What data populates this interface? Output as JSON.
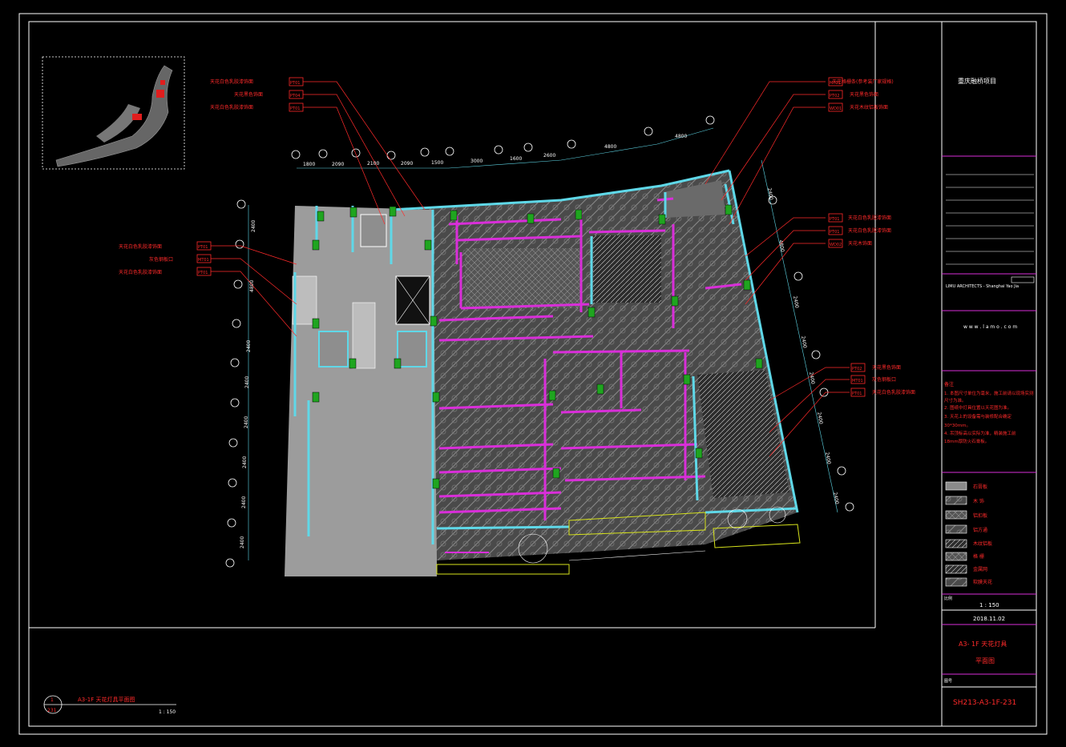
{
  "project_title": "重庆融桥项目",
  "firm": {
    "name_line": "LIMU ARCHITECTS - Shanghai Yao Jia",
    "website": "w w w . l a m o . c o m"
  },
  "notes": {
    "heading": "备注",
    "lines": [
      "1. 本图尺寸单位为毫米，施工前请以现场实测",
      "尺寸为准。",
      "2. 图纸中灯具位置以天花图为准。",
      "3. 天花上的设备需与装修配合确定",
      "30*30mm。",
      "4. 吊顶标高以实际为准，精装施工前",
      "18mm厚防火石膏板。"
    ]
  },
  "legend": [
    {
      "label": "石膏板"
    },
    {
      "label": "木  饰"
    },
    {
      "label": "铝扣板"
    },
    {
      "label": "铝方通"
    },
    {
      "label": "木纹铝板"
    },
    {
      "label": "格  栅"
    },
    {
      "label": "金属网"
    },
    {
      "label": "软膜天花"
    }
  ],
  "scale_label": "比例",
  "scale": "1 : 150",
  "date_label": "日期",
  "date": "2018.11.02",
  "sheet_title_line1": "A3- 1F  天花灯具",
  "sheet_title_line2": "平面图",
  "number_label": "图号",
  "drawing_number": "SH213-A3-1F-231",
  "bottom_caption": {
    "num": "1",
    "sheet": "231",
    "title": "A3-1F  天花灯具平面图",
    "scale": "1 : 150"
  },
  "top_dims": [
    "1800",
    "2090",
    "2100",
    "2090",
    "1500",
    "3000",
    "1600",
    "2600",
    "4800",
    "4800"
  ],
  "left_dims": [
    "2400",
    "4800",
    "2400",
    "2400",
    "2400",
    "2400",
    "2400",
    "2400",
    "2400"
  ],
  "right_dims": [
    "2400",
    "4800",
    "2400",
    "2400",
    "2400",
    "2400",
    "2400",
    "2400"
  ],
  "left_labels": [
    {
      "text": "天花白色乳胶漆饰面",
      "tag": "PT01"
    },
    {
      "text": "灰色钢板口",
      "tag": "MT01"
    },
    {
      "text": "天花白色乳胶漆饰面",
      "tag": "PT01"
    }
  ],
  "top_left_labels": [
    {
      "text": "天花白色乳胶漆饰面",
      "tag": "PT01"
    },
    {
      "text": "天花黑色饰面",
      "tag": "PT04"
    },
    {
      "text": "天花白色乳胶漆饰面",
      "tag": "PT01"
    }
  ],
  "top_right_labels": [
    {
      "text": "天花格栅条(参考装厂家规格)",
      "tag": "MT01"
    },
    {
      "text": "天花黑色饰面",
      "tag": "PT02"
    },
    {
      "text": "天花木纹铝板饰面",
      "tag": "WD01"
    }
  ],
  "mid_right_labels": [
    {
      "text": "天花白色乳胶漆饰面",
      "tag": "PT01"
    },
    {
      "text": "天花白色乳胶漆饰面",
      "tag": "PT01"
    },
    {
      "text": "天花木饰面",
      "tag": "WD02"
    }
  ],
  "low_right_labels": [
    {
      "text": "天花黑色饰面",
      "tag": "PT02"
    },
    {
      "text": "灰色钢板口",
      "tag": "MT01"
    },
    {
      "text": "天花白色乳胶漆饰面",
      "tag": "PT01"
    }
  ],
  "colors": {
    "background": "#000000",
    "frame": "#ffffff",
    "magenta": "#d92ed9",
    "cyan": "#5fd8e8",
    "red": "#ff2a2a",
    "green": "#1fa51f",
    "gray": "#9c9c9c"
  }
}
